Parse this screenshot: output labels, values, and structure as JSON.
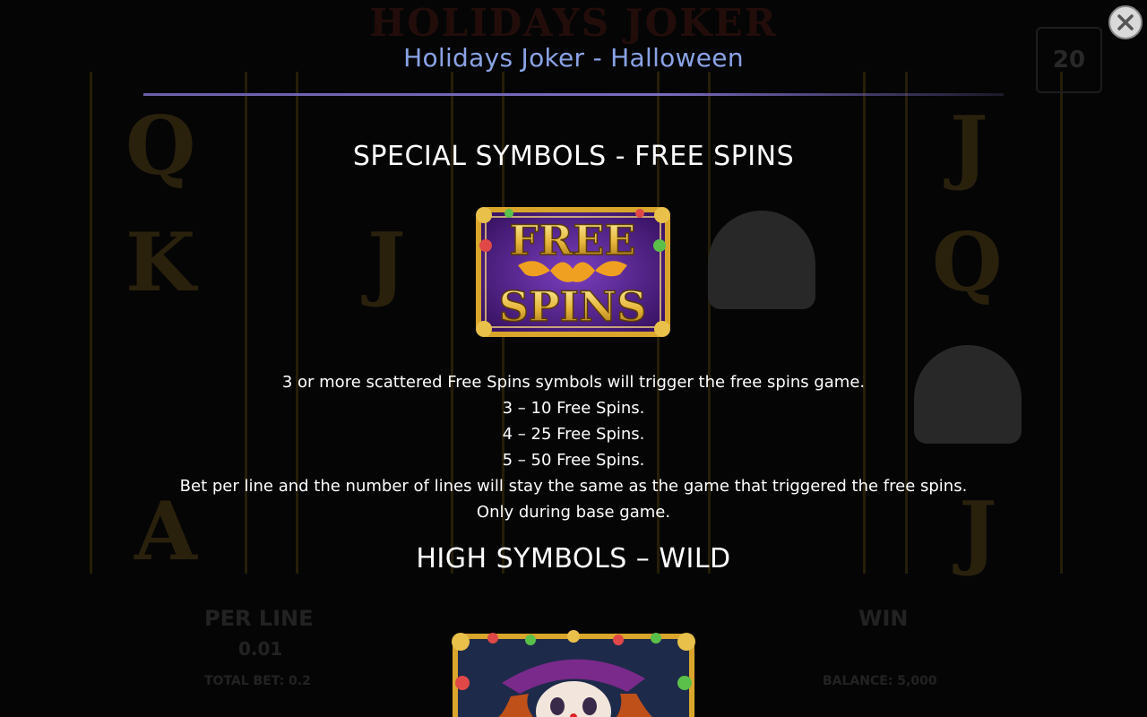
{
  "background": {
    "game_logo": "HOLIDAYS JOKER",
    "bet_label": "PER LINE",
    "bet_value": "0.01",
    "total_bet": "TOTAL BET: 0.2",
    "win_label": "WIN",
    "balance": "BALANCE: 5,000",
    "lines": "20"
  },
  "dialog": {
    "title": "Holidays Joker - Halloween",
    "close_icon": "close-icon"
  },
  "free_spins_section": {
    "heading": "SPECIAL SYMBOLS - FREE SPINS",
    "symbol_text_top": "FREE",
    "symbol_text_bottom": "SPINS",
    "lines": [
      "3 or more scattered Free Spins symbols will trigger the free spins game.",
      "3 – 10 Free Spins.",
      "4 – 25 Free Spins.",
      "5 – 50 Free Spins.",
      "Bet per line and the number of lines will stay the same as the game that triggered the free spins.",
      "Only during base game."
    ]
  },
  "wild_section": {
    "heading": "HIGH SYMBOLS – WILD"
  },
  "colors": {
    "title": "#8aa3e6",
    "divider": "#6b5fa8",
    "gold": "#e0b33a",
    "purple": "#5b2a8c"
  }
}
